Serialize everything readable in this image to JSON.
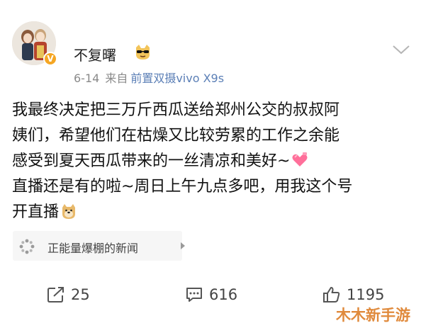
{
  "post": {
    "username": "不复曙",
    "date": "6-14",
    "source_prefix": "来自",
    "source_device": "前置双摄vivo X9s",
    "content_lines": [
      "我最终决定把三万斤西瓜送给郑州公交的叔叔阿",
      "姨们，希望他们在枯燥又比较劳累的工作之余能",
      "感受到夏天西瓜带来的一丝清凉和美好~",
      "直播还是有的啦~周日上午九点多吧，用我这个号",
      "开直播"
    ],
    "topic_label": "正能量爆棚的新闻"
  },
  "actions": {
    "repost_count": "25",
    "comment_count": "616",
    "like_count": "1195"
  },
  "watermark": "木木新手游",
  "icons": {
    "verified": "verified-badge-icon",
    "cool_emoji": "sunglasses-dog-emoji-icon",
    "heart_emoji": "heart-gift-emoji-icon",
    "doge_emoji": "doge-emoji-icon",
    "topic": "topic-sparkle-icon",
    "repost": "repost-icon",
    "comment": "comment-icon",
    "like": "thumbs-up-icon",
    "more": "chevron-down-icon"
  },
  "colors": {
    "source_link": "#5b7fb6",
    "badge": "#f5a623",
    "watermark": "#e08a3c"
  }
}
